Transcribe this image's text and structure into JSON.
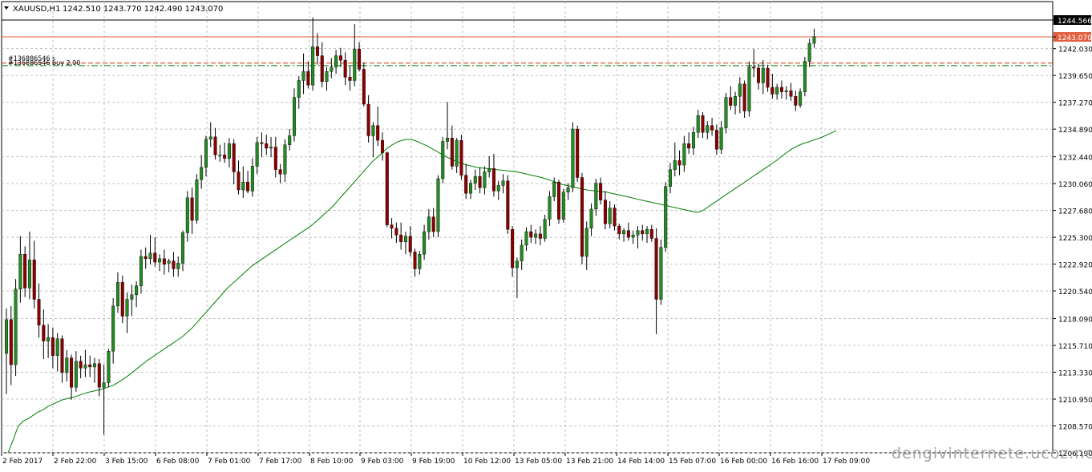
{
  "header": {
    "symbol": "XAUUSD,H1",
    "ohlc": "1242.510 1243.770 1242.490 1243.070"
  },
  "watermark": "dengivinternete.ucoz.net",
  "chart_data": {
    "type": "candlestick",
    "title": "XAUUSD,H1",
    "xlabel": "",
    "ylabel": "",
    "grid": true,
    "ylim": [
      1206.19,
      1246.2
    ],
    "y_ticks": [
      "1244.566",
      "1243.070",
      "1242.030",
      "1239.650",
      "1237.270",
      "1234.890",
      "1232.440",
      "1230.060",
      "1227.680",
      "1225.300",
      "1222.920",
      "1220.540",
      "1218.090",
      "1215.710",
      "1213.330",
      "1210.950",
      "1208.570",
      "1206.190"
    ],
    "x_ticks": [
      "2 Feb 2017",
      "2 Feb 22:00",
      "3 Feb 15:00",
      "6 Feb 08:00",
      "7 Feb 01:00",
      "7 Feb 17:00",
      "8 Feb 10:00",
      "9 Feb 03:00",
      "9 Feb 19:00",
      "10 Feb 12:00",
      "13 Feb 05:00",
      "13 Feb 21:00",
      "14 Feb 14:00",
      "15 Feb 07:00",
      "16 Feb 00:00",
      "16 Feb 16:00",
      "17 Feb 09:00"
    ],
    "levels": [
      {
        "name": "high_line",
        "value": 1244.566,
        "label": "1244.566",
        "color": "#000000"
      },
      {
        "name": "bid_line",
        "value": 1243.07,
        "label": "1243.070",
        "color": "#e06040"
      },
      {
        "name": "order_stop",
        "value": 1240.75,
        "label": "#136886546 s",
        "color": "#cc3300"
      },
      {
        "name": "order_open",
        "value": 1240.52,
        "label": "#136886546 buy 2.00",
        "color": "#008000"
      }
    ],
    "ma_color": "#008000",
    "bull_color": "#228b22",
    "bear_color": "#8b0000",
    "candles": [
      [
        1215.0,
        1219.0,
        1211.4,
        1218.0
      ],
      [
        1218.0,
        1219.2,
        1212.2,
        1214.0
      ],
      [
        1214.0,
        1221.6,
        1213.0,
        1220.7
      ],
      [
        1220.7,
        1225.4,
        1219.5,
        1223.8
      ],
      [
        1223.8,
        1224.5,
        1220.0,
        1220.8
      ],
      [
        1220.8,
        1225.8,
        1219.8,
        1223.3
      ],
      [
        1223.3,
        1225.0,
        1219.0,
        1219.8
      ],
      [
        1219.8,
        1221.2,
        1216.4,
        1217.5
      ],
      [
        1217.5,
        1218.9,
        1214.5,
        1216.1
      ],
      [
        1216.1,
        1217.6,
        1214.6,
        1216.4
      ],
      [
        1216.4,
        1217.3,
        1213.7,
        1214.8
      ],
      [
        1214.8,
        1216.8,
        1213.4,
        1216.3
      ],
      [
        1216.3,
        1216.6,
        1212.4,
        1213.3
      ],
      [
        1213.3,
        1215.3,
        1212.5,
        1214.6
      ],
      [
        1214.6,
        1214.9,
        1210.9,
        1212.0
      ],
      [
        1212.0,
        1215.2,
        1211.6,
        1214.3
      ],
      [
        1214.3,
        1214.8,
        1212.8,
        1213.7
      ],
      [
        1213.7,
        1215.3,
        1212.9,
        1214.0
      ],
      [
        1214.0,
        1214.8,
        1212.9,
        1213.8
      ],
      [
        1213.8,
        1214.6,
        1212.4,
        1214.1
      ],
      [
        1214.1,
        1214.5,
        1211.2,
        1212.0
      ],
      [
        1212.0,
        1214.0,
        1207.8,
        1212.4
      ],
      [
        1212.4,
        1215.4,
        1212.0,
        1215.2
      ],
      [
        1215.2,
        1219.9,
        1214.1,
        1219.2
      ],
      [
        1219.2,
        1222.2,
        1218.6,
        1221.3
      ],
      [
        1221.3,
        1221.9,
        1217.7,
        1218.3
      ],
      [
        1218.3,
        1220.4,
        1216.8,
        1219.8
      ],
      [
        1219.8,
        1221.1,
        1218.3,
        1220.2
      ],
      [
        1220.2,
        1221.4,
        1219.1,
        1221.0
      ],
      [
        1221.0,
        1224.2,
        1220.3,
        1223.6
      ],
      [
        1223.6,
        1224.4,
        1222.5,
        1223.4
      ],
      [
        1223.4,
        1225.5,
        1222.9,
        1223.9
      ],
      [
        1223.9,
        1225.3,
        1222.7,
        1223.1
      ],
      [
        1223.1,
        1223.8,
        1222.3,
        1223.4
      ],
      [
        1223.4,
        1224.2,
        1222.0,
        1222.9
      ],
      [
        1223.0,
        1223.4,
        1222.2,
        1223.2
      ],
      [
        1223.2,
        1224.0,
        1221.8,
        1222.5
      ],
      [
        1222.5,
        1223.6,
        1221.8,
        1223.0
      ],
      [
        1223.0,
        1225.9,
        1222.3,
        1225.7
      ],
      [
        1225.7,
        1229.4,
        1224.9,
        1228.8
      ],
      [
        1228.8,
        1229.7,
        1225.6,
        1226.8
      ],
      [
        1226.8,
        1230.9,
        1226.5,
        1230.4
      ],
      [
        1230.4,
        1232.6,
        1229.6,
        1231.5
      ],
      [
        1231.5,
        1234.3,
        1230.7,
        1234.0
      ],
      [
        1234.0,
        1235.5,
        1233.3,
        1234.2
      ],
      [
        1234.2,
        1235.0,
        1232.2,
        1232.6
      ],
      [
        1232.6,
        1233.5,
        1232.0,
        1232.6
      ],
      [
        1232.6,
        1233.7,
        1231.9,
        1232.3
      ],
      [
        1232.3,
        1234.1,
        1231.5,
        1233.6
      ],
      [
        1233.6,
        1234.0,
        1230.0,
        1231.1
      ],
      [
        1231.1,
        1232.1,
        1229.1,
        1229.5
      ],
      [
        1229.5,
        1231.6,
        1228.8,
        1230.2
      ],
      [
        1230.2,
        1231.2,
        1229.2,
        1229.4
      ],
      [
        1229.4,
        1232.3,
        1228.9,
        1231.6
      ],
      [
        1231.6,
        1234.2,
        1230.9,
        1233.7
      ],
      [
        1233.7,
        1234.6,
        1232.4,
        1233.6
      ],
      [
        1233.6,
        1234.4,
        1232.6,
        1233.2
      ],
      [
        1233.2,
        1234.2,
        1232.4,
        1233.3
      ],
      [
        1233.3,
        1234.2,
        1230.6,
        1231.3
      ],
      [
        1231.3,
        1231.8,
        1230.1,
        1230.9
      ],
      [
        1230.9,
        1234.0,
        1230.2,
        1233.5
      ],
      [
        1233.5,
        1234.9,
        1233.0,
        1234.3
      ],
      [
        1234.3,
        1238.5,
        1233.8,
        1237.7
      ],
      [
        1237.7,
        1239.6,
        1236.7,
        1239.2
      ],
      [
        1239.2,
        1241.6,
        1238.0,
        1240.0
      ],
      [
        1240.0,
        1240.9,
        1238.5,
        1238.8
      ],
      [
        1238.8,
        1244.8,
        1238.3,
        1242.2
      ],
      [
        1242.2,
        1243.4,
        1240.6,
        1241.4
      ],
      [
        1241.4,
        1242.6,
        1238.6,
        1239.1
      ],
      [
        1239.1,
        1240.4,
        1238.3,
        1240.0
      ],
      [
        1240.0,
        1241.2,
        1239.4,
        1240.4
      ],
      [
        1240.4,
        1241.9,
        1239.8,
        1241.4
      ],
      [
        1241.4,
        1242.1,
        1240.4,
        1241.0
      ],
      [
        1241.0,
        1241.7,
        1238.8,
        1239.5
      ],
      [
        1239.5,
        1240.5,
        1238.3,
        1239.2
      ],
      [
        1239.2,
        1244.2,
        1238.7,
        1242.0
      ],
      [
        1242.0,
        1242.6,
        1240.0,
        1240.2
      ],
      [
        1240.2,
        1240.8,
        1236.9,
        1237.1
      ],
      [
        1237.1,
        1237.9,
        1233.7,
        1234.3
      ],
      [
        1234.3,
        1235.5,
        1232.4,
        1235.2
      ],
      [
        1235.2,
        1236.9,
        1233.4,
        1233.9
      ],
      [
        1233.9,
        1234.6,
        1232.1,
        1232.8
      ],
      [
        1232.8,
        1232.9,
        1226.2,
        1226.4
      ],
      [
        1226.4,
        1227.0,
        1225.2,
        1226.1
      ],
      [
        1226.1,
        1226.6,
        1224.8,
        1225.5
      ],
      [
        1225.5,
        1226.6,
        1224.2,
        1224.9
      ],
      [
        1224.9,
        1225.8,
        1223.8,
        1225.4
      ],
      [
        1225.4,
        1226.3,
        1223.6,
        1224.0
      ],
      [
        1224.0,
        1224.3,
        1221.8,
        1222.5
      ],
      [
        1222.5,
        1224.1,
        1222.0,
        1223.8
      ],
      [
        1223.8,
        1226.4,
        1223.3,
        1225.8
      ],
      [
        1225.8,
        1227.8,
        1225.1,
        1227.1
      ],
      [
        1227.1,
        1227.9,
        1225.3,
        1225.8
      ],
      [
        1225.8,
        1230.8,
        1225.3,
        1230.5
      ],
      [
        1230.5,
        1234.2,
        1230.1,
        1233.8
      ],
      [
        1233.8,
        1237.3,
        1233.1,
        1234.1
      ],
      [
        1234.1,
        1235.2,
        1231.3,
        1231.6
      ],
      [
        1231.6,
        1234.1,
        1231.0,
        1233.9
      ],
      [
        1233.9,
        1234.4,
        1230.4,
        1230.8
      ],
      [
        1230.8,
        1231.8,
        1228.7,
        1229.2
      ],
      [
        1229.2,
        1230.4,
        1228.7,
        1230.1
      ],
      [
        1230.1,
        1231.3,
        1229.5,
        1230.7
      ],
      [
        1230.7,
        1231.5,
        1229.2,
        1229.7
      ],
      [
        1229.7,
        1231.6,
        1229.1,
        1231.1
      ],
      [
        1231.1,
        1232.5,
        1230.6,
        1231.4
      ],
      [
        1231.4,
        1232.7,
        1228.9,
        1229.4
      ],
      [
        1229.4,
        1230.3,
        1228.6,
        1229.9
      ],
      [
        1229.9,
        1230.9,
        1229.2,
        1230.3
      ],
      [
        1230.3,
        1230.8,
        1225.6,
        1226.0
      ],
      [
        1226.0,
        1226.3,
        1221.8,
        1222.6
      ],
      [
        1222.6,
        1223.5,
        1219.9,
        1223.2
      ],
      [
        1223.2,
        1225.1,
        1222.4,
        1224.6
      ],
      [
        1224.6,
        1226.2,
        1224.1,
        1225.8
      ],
      [
        1225.8,
        1226.4,
        1224.8,
        1225.3
      ],
      [
        1225.3,
        1226.0,
        1224.7,
        1225.6
      ],
      [
        1225.6,
        1226.3,
        1224.6,
        1225.2
      ],
      [
        1225.2,
        1227.3,
        1224.9,
        1226.9
      ],
      [
        1226.9,
        1229.4,
        1226.3,
        1228.9
      ],
      [
        1228.9,
        1230.6,
        1228.5,
        1230.2
      ],
      [
        1230.2,
        1230.4,
        1226.5,
        1226.9
      ],
      [
        1226.9,
        1229.6,
        1226.6,
        1229.3
      ],
      [
        1229.3,
        1230.1,
        1228.6,
        1229.7
      ],
      [
        1229.7,
        1235.5,
        1229.3,
        1234.9
      ],
      [
        1234.9,
        1235.2,
        1230.2,
        1230.6
      ],
      [
        1230.6,
        1231.0,
        1222.9,
        1223.6
      ],
      [
        1223.6,
        1226.7,
        1222.4,
        1226.1
      ],
      [
        1226.1,
        1228.3,
        1225.4,
        1227.8
      ],
      [
        1227.8,
        1230.5,
        1227.2,
        1230.1
      ],
      [
        1230.1,
        1230.6,
        1228.2,
        1228.6
      ],
      [
        1228.6,
        1229.4,
        1226.0,
        1226.5
      ],
      [
        1226.5,
        1228.5,
        1226.1,
        1227.9
      ],
      [
        1227.9,
        1228.2,
        1225.9,
        1226.3
      ],
      [
        1226.3,
        1226.5,
        1225.1,
        1225.6
      ],
      [
        1225.6,
        1226.1,
        1224.9,
        1225.9
      ],
      [
        1225.9,
        1226.6,
        1225.0,
        1225.3
      ],
      [
        1225.3,
        1225.9,
        1224.7,
        1225.5
      ],
      [
        1225.5,
        1226.3,
        1224.3,
        1225.9
      ],
      [
        1225.9,
        1226.4,
        1225.0,
        1225.6
      ],
      [
        1225.6,
        1226.3,
        1224.8,
        1226.0
      ],
      [
        1226.0,
        1226.4,
        1224.9,
        1225.2
      ],
      [
        1225.2,
        1226.1,
        1216.7,
        1219.8
      ],
      [
        1219.8,
        1225.1,
        1219.3,
        1224.4
      ],
      [
        1224.4,
        1230.2,
        1224.0,
        1229.8
      ],
      [
        1229.8,
        1231.9,
        1229.2,
        1231.3
      ],
      [
        1231.3,
        1233.7,
        1230.7,
        1232.1
      ],
      [
        1232.1,
        1233.0,
        1230.8,
        1231.7
      ],
      [
        1231.7,
        1234.3,
        1231.1,
        1233.6
      ],
      [
        1233.6,
        1234.6,
        1232.7,
        1233.2
      ],
      [
        1233.2,
        1235.1,
        1232.6,
        1234.6
      ],
      [
        1234.6,
        1236.6,
        1234.1,
        1236.1
      ],
      [
        1236.1,
        1236.4,
        1234.1,
        1234.6
      ],
      [
        1234.6,
        1235.6,
        1234.0,
        1235.2
      ],
      [
        1235.2,
        1235.9,
        1234.3,
        1234.8
      ],
      [
        1234.8,
        1235.3,
        1232.6,
        1233.1
      ],
      [
        1233.1,
        1235.6,
        1232.7,
        1235.0
      ],
      [
        1235.0,
        1238.1,
        1234.5,
        1237.7
      ],
      [
        1237.7,
        1238.7,
        1236.6,
        1237.0
      ],
      [
        1237.0,
        1238.2,
        1236.2,
        1237.8
      ],
      [
        1237.8,
        1239.5,
        1236.3,
        1238.9
      ],
      [
        1238.9,
        1239.2,
        1235.9,
        1236.5
      ],
      [
        1236.5,
        1240.9,
        1236.0,
        1240.4
      ],
      [
        1240.4,
        1242.0,
        1239.5,
        1240.3
      ],
      [
        1240.3,
        1240.7,
        1238.4,
        1239.0
      ],
      [
        1239.0,
        1241.0,
        1238.0,
        1240.3
      ],
      [
        1240.3,
        1240.6,
        1238.2,
        1238.6
      ],
      [
        1238.6,
        1239.8,
        1237.6,
        1238.0
      ],
      [
        1238.0,
        1238.9,
        1237.5,
        1238.6
      ],
      [
        1238.6,
        1239.2,
        1237.6,
        1238.2
      ],
      [
        1238.2,
        1238.7,
        1237.5,
        1238.3
      ],
      [
        1238.3,
        1239.0,
        1237.4,
        1237.8
      ],
      [
        1237.8,
        1238.3,
        1236.5,
        1237.0
      ],
      [
        1237.0,
        1238.5,
        1236.8,
        1238.2
      ],
      [
        1238.2,
        1241.3,
        1237.8,
        1240.9
      ],
      [
        1240.9,
        1242.9,
        1240.4,
        1242.5
      ],
      [
        1242.5,
        1243.8,
        1242.1,
        1243.1
      ]
    ],
    "moving_average": [
      1206.19,
      1207.3,
      1208.5,
      1209.0,
      1209.2,
      1209.5,
      1209.8,
      1210.0,
      1210.3,
      1210.5,
      1210.7,
      1210.9,
      1211.0,
      1211.1,
      1211.25,
      1211.4,
      1211.55,
      1211.65,
      1211.75,
      1211.85,
      1212.0,
      1212.15,
      1212.4,
      1212.7,
      1213.0,
      1213.35,
      1213.7,
      1214.05,
      1214.4,
      1214.7,
      1215.0,
      1215.3,
      1215.6,
      1215.9,
      1216.2,
      1216.5,
      1216.9,
      1217.3,
      1217.8,
      1218.3,
      1218.8,
      1219.3,
      1219.8,
      1220.3,
      1220.8,
      1221.2,
      1221.6,
      1222.0,
      1222.4,
      1222.8,
      1223.1,
      1223.4,
      1223.7,
      1224.0,
      1224.3,
      1224.6,
      1224.9,
      1225.2,
      1225.5,
      1225.8,
      1226.1,
      1226.4,
      1226.8,
      1227.2,
      1227.6,
      1228.0,
      1228.5,
      1229.0,
      1229.5,
      1230.0,
      1230.5,
      1231.0,
      1231.5,
      1232.0,
      1232.4,
      1232.8,
      1233.2,
      1233.5,
      1233.75,
      1233.9,
      1234.0,
      1233.95,
      1233.8,
      1233.6,
      1233.4,
      1233.15,
      1232.9,
      1232.65,
      1232.4,
      1232.2,
      1232.0,
      1231.85,
      1231.7,
      1231.6,
      1231.5,
      1231.45,
      1231.4,
      1231.35,
      1231.3,
      1231.25,
      1231.2,
      1231.15,
      1231.1,
      1231.0,
      1230.9,
      1230.8,
      1230.7,
      1230.6,
      1230.45,
      1230.3,
      1230.15,
      1230.0,
      1229.9,
      1229.8,
      1229.7,
      1229.6,
      1229.5,
      1229.45,
      1229.4,
      1229.35,
      1229.3,
      1229.2,
      1229.1,
      1229.0,
      1228.9,
      1228.8,
      1228.7,
      1228.6,
      1228.5,
      1228.4,
      1228.3,
      1228.2,
      1228.1,
      1228.0,
      1227.9,
      1227.8,
      1227.7,
      1227.6,
      1227.5,
      1227.6,
      1227.9,
      1228.2,
      1228.5,
      1228.8,
      1229.1,
      1229.4,
      1229.7,
      1230.0,
      1230.3,
      1230.6,
      1230.9,
      1231.2,
      1231.5,
      1231.8,
      1232.1,
      1232.45,
      1232.8,
      1233.1,
      1233.35,
      1233.55,
      1233.7,
      1233.85,
      1234.0,
      1234.15,
      1234.35,
      1234.55,
      1234.75
    ]
  }
}
